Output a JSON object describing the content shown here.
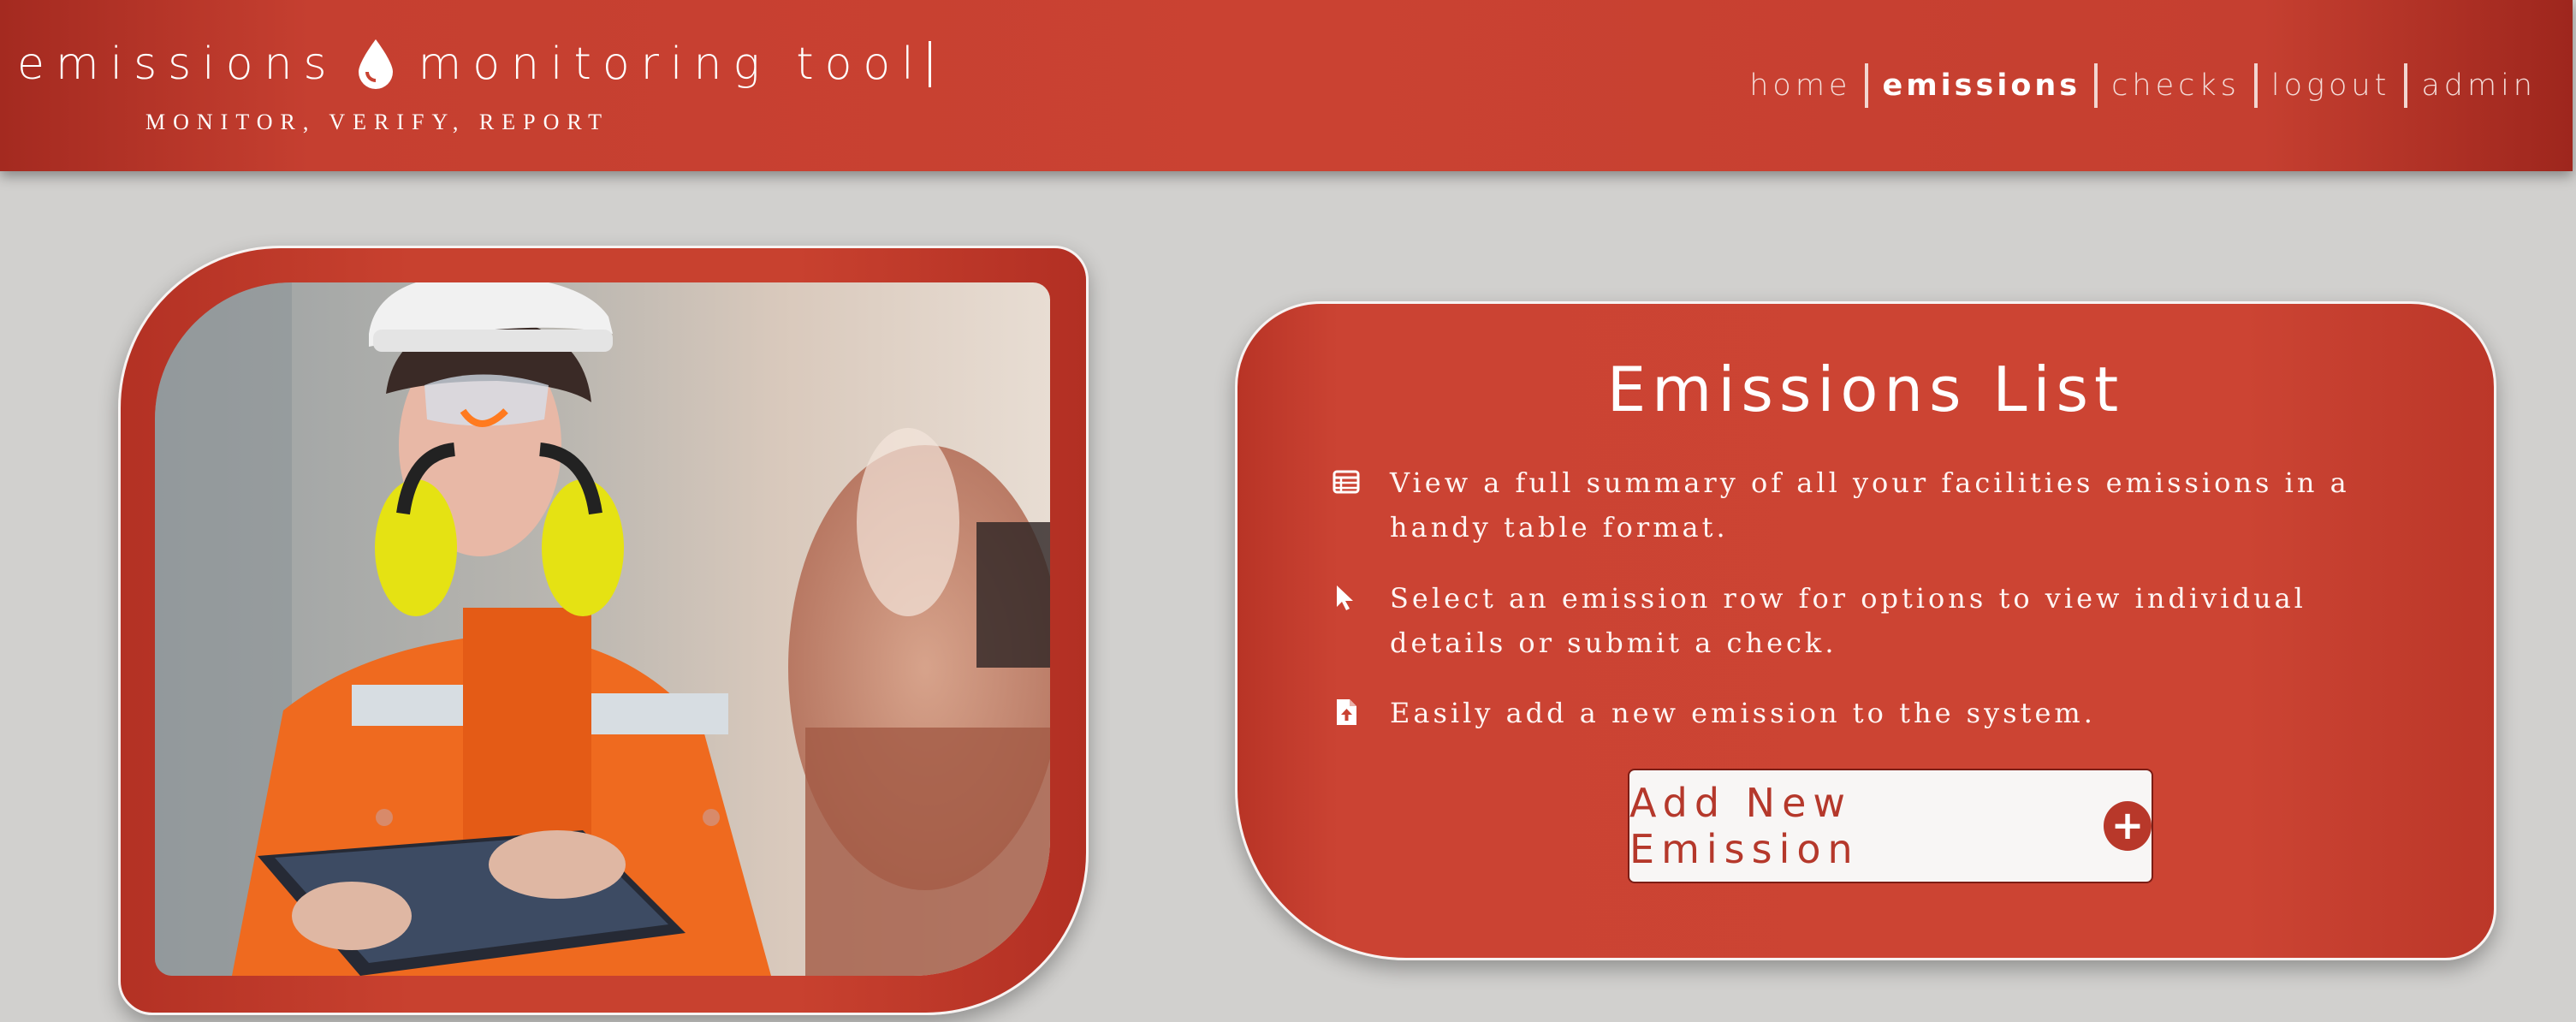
{
  "header": {
    "title_part1": "emissions",
    "title_part2": "monitoring tool",
    "tagline": "MONITOR, VERIFY, REPORT",
    "logo_icon": "drop-icon",
    "nav": [
      {
        "label": "home",
        "active": false
      },
      {
        "label": "emissions",
        "active": true
      },
      {
        "label": "checks",
        "active": false
      },
      {
        "label": "logout",
        "active": false
      },
      {
        "label": "admin",
        "active": false
      }
    ]
  },
  "hero_image": {
    "description_icon": "engineer-with-tablet-photo"
  },
  "panel": {
    "title": "Emissions List",
    "features": [
      {
        "icon": "table-icon",
        "text": "View a full summary of all your facilities emissions in a handy table format."
      },
      {
        "icon": "cursor-icon",
        "text": "Select an emission row for options to view individual details or submit a check."
      },
      {
        "icon": "file-upload-icon",
        "text": "Easily add a new emission to the system."
      }
    ],
    "add_button_label": "Add New Emission",
    "add_button_icon": "plus-circle-icon"
  },
  "colors": {
    "brand_red": "#c94232",
    "background": "#d1d0ce",
    "button_bg": "#f8f6f5"
  }
}
